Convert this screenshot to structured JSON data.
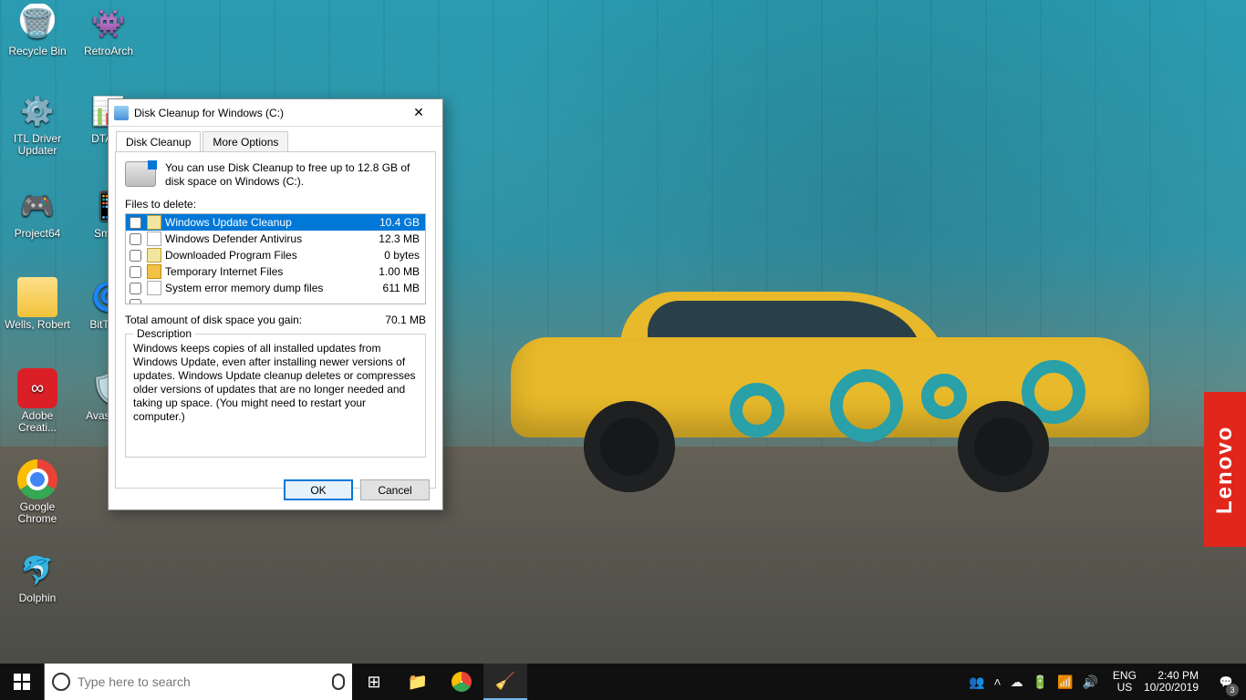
{
  "desktop_icons": [
    {
      "label": "Recycle Bin"
    },
    {
      "label": "RetroArch"
    },
    {
      "label": "ITL Driver Updater"
    },
    {
      "label": "DTALE"
    },
    {
      "label": "Project64"
    },
    {
      "label": "Smart"
    },
    {
      "label": "Wells, Robert"
    },
    {
      "label": "BitTo W"
    },
    {
      "label": "Adobe Creati..."
    },
    {
      "label": "Avas Anti"
    },
    {
      "label": "Google Chrome"
    },
    {
      "label": "Dolphin"
    }
  ],
  "lenovo": "Lenovo",
  "dialog": {
    "title": "Disk Cleanup for Windows (C:)",
    "tabs": {
      "active": "Disk Cleanup",
      "inactive": "More Options"
    },
    "info": "You can use Disk Cleanup to free up to 12.8 GB of disk space on Windows (C:).",
    "files_label": "Files to delete:",
    "files": [
      {
        "name": "Windows Update Cleanup",
        "size": "10.4 GB",
        "selected": true
      },
      {
        "name": "Windows Defender Antivirus",
        "size": "12.3 MB"
      },
      {
        "name": "Downloaded Program Files",
        "size": "0 bytes"
      },
      {
        "name": "Temporary Internet Files",
        "size": "1.00 MB"
      },
      {
        "name": "System error memory dump files",
        "size": "611 MB"
      }
    ],
    "total_label": "Total amount of disk space you gain:",
    "total_value": "70.1 MB",
    "desc_title": "Description",
    "desc": "Windows keeps copies of all installed updates from Windows Update, even after installing newer versions of updates. Windows Update cleanup deletes or compresses older versions of updates that are no longer needed and taking up space. (You might need to restart your computer.)",
    "ok": "OK",
    "cancel": "Cancel"
  },
  "taskbar": {
    "search_placeholder": "Type here to search",
    "lang1": "ENG",
    "lang2": "US",
    "time": "2:40 PM",
    "date": "10/20/2019",
    "notif_count": "3"
  }
}
